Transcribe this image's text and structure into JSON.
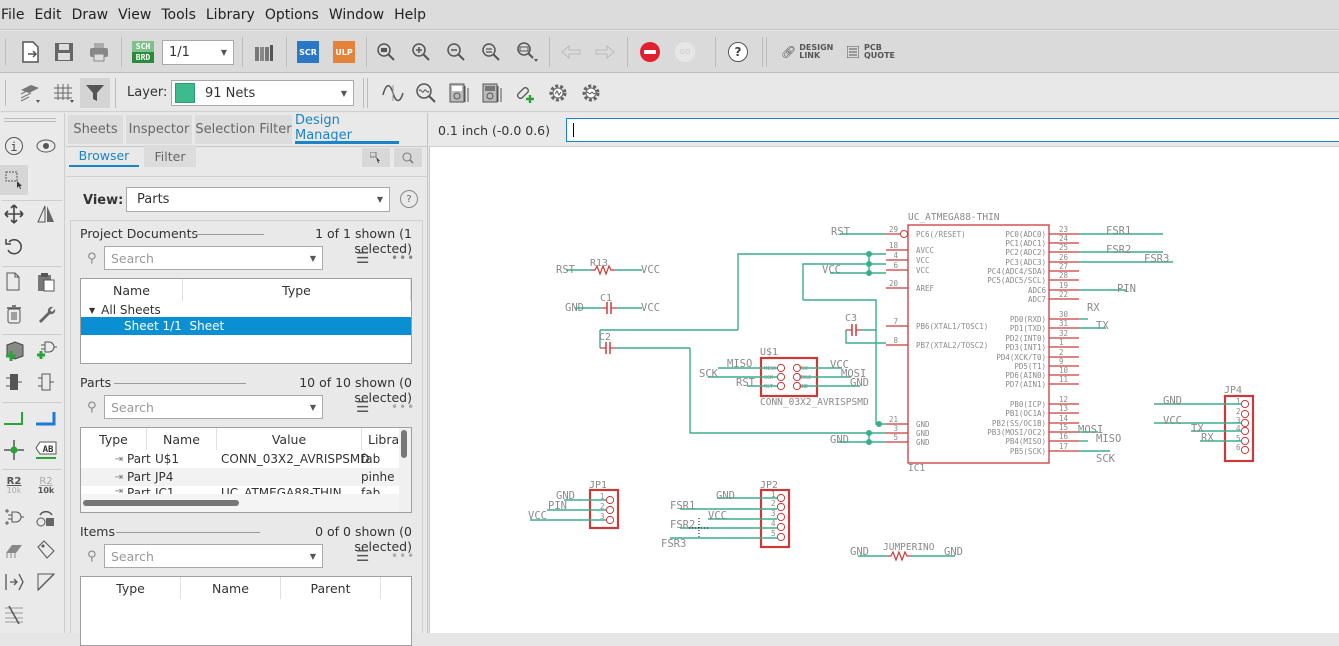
{
  "menu": [
    "File",
    "Edit",
    "Draw",
    "View",
    "Tools",
    "Library",
    "Options",
    "Window",
    "Help"
  ],
  "toolbar": {
    "sheet_select": "1/1",
    "sch_brd_top": "SCH",
    "sch_brd_bottom": "BRD",
    "scr_label": "SCR",
    "ulp_label": "ULP",
    "go_label": "GO",
    "help_label": "?",
    "design_link": [
      "DESIGN",
      "LINK"
    ],
    "pcb_quote": [
      "PCB",
      "QUOTE"
    ],
    "layer_label": "Layer:",
    "layer_value": "91 Nets",
    "layer_color": "#3dbb8f",
    "stop_color": "#e0202e"
  },
  "panel": {
    "tabs": [
      "Sheets",
      "Inspector",
      "Selection Filter",
      "Design Manager"
    ],
    "active_tab": "Design Manager",
    "subtabs": [
      "Browser",
      "Filter"
    ],
    "view_label": "View:",
    "view_value": "Parts",
    "project_documents": {
      "title": "Project Documents",
      "count": "1 of 1 shown (1 selected)",
      "search_placeholder": "Search",
      "columns": [
        "Name",
        "Type"
      ],
      "group": "All Sheets",
      "rows": [
        {
          "name": "Sheet 1/1",
          "type": "Sheet",
          "selected": true
        }
      ]
    },
    "parts": {
      "title": "Parts",
      "count": "10 of 10 shown (0 selected)",
      "search_placeholder": "Search",
      "columns": [
        "Type",
        "Name",
        "Value",
        "Libra"
      ],
      "rows": [
        {
          "type": "Part",
          "name": "U$1",
          "value": "CONN_03X2_AVRISPSMD",
          "library": "fab"
        },
        {
          "type": "Part",
          "name": "JP4",
          "value": "",
          "library": "pinhe"
        },
        {
          "type": "Part",
          "name": "IC1",
          "value": "UC_ATMEGA88-THIN",
          "library": "fab"
        }
      ]
    },
    "items": {
      "title": "Items",
      "count": "0 of 0 shown (0 selected)",
      "search_placeholder": "Search",
      "columns": [
        "Type",
        "Name",
        "Parent"
      ]
    }
  },
  "coord": {
    "readout": "0.1 inch (-0.0 0.6)",
    "command_value": ""
  },
  "lefttools": {
    "r2_top": "R2",
    "r2_bottom": "10k",
    "ab": "AB"
  },
  "schematic": {
    "ic": {
      "name": "IC1",
      "value": "UC_ATMEGA88-THIN",
      "left_pins": [
        {
          "num": "29",
          "label": "PC6(/RESET)"
        },
        {
          "num": "18",
          "label": "AVCC"
        },
        {
          "num": "4",
          "label": "VCC"
        },
        {
          "num": "6",
          "label": "VCC"
        },
        {
          "num": "20",
          "label": "AREF"
        },
        {
          "num": "7",
          "label": "PB6(XTAL1/TOSC1)"
        },
        {
          "num": "8",
          "label": "PB7(XTAL2/TOSC2)"
        },
        {
          "num": "21",
          "label": "GND"
        },
        {
          "num": "3",
          "label": "GND"
        },
        {
          "num": "5",
          "label": "GND"
        }
      ],
      "right_pins": [
        {
          "num": "23",
          "label": "PC0(ADC0)"
        },
        {
          "num": "24",
          "label": "PC1(ADC1)"
        },
        {
          "num": "25",
          "label": "PC2(ADC2)"
        },
        {
          "num": "26",
          "label": "PC3(ADC3)"
        },
        {
          "num": "27",
          "label": "PC4(ADC4/SDA)"
        },
        {
          "num": "28",
          "label": "PC5(ADC5/SCL)"
        },
        {
          "num": "19",
          "label": "ADC6"
        },
        {
          "num": "22",
          "label": "ADC7"
        },
        {
          "num": "30",
          "label": "PD0(RXD)"
        },
        {
          "num": "31",
          "label": "PD1(TXD)"
        },
        {
          "num": "32",
          "label": "PD2(INT0)"
        },
        {
          "num": "1",
          "label": "PD3(INT1)"
        },
        {
          "num": "2",
          "label": "PD4(XCK/T0)"
        },
        {
          "num": "9",
          "label": "PD5(T1)"
        },
        {
          "num": "10",
          "label": "PD6(AIN0)"
        },
        {
          "num": "11",
          "label": "PD7(AIN1)"
        },
        {
          "num": "12",
          "label": "PB0(ICP)"
        },
        {
          "num": "13",
          "label": "PB1(OC1A)"
        },
        {
          "num": "14",
          "label": "PB2(SS/OC1B)"
        },
        {
          "num": "15",
          "label": "PB3(MOSI/OC2)"
        },
        {
          "num": "16",
          "label": "PB4(MISO)"
        },
        {
          "num": "17",
          "label": "PB5(SCK)"
        }
      ]
    },
    "net_labels": {
      "rst_ic": "RST",
      "fsr1": "FSR1",
      "fsr2": "FSR2",
      "fsr3": "FSR3",
      "pin": "PIN",
      "rx": "RX",
      "tx": "TX",
      "mosi": "MOSI",
      "miso": "MISO",
      "sck": "SCK",
      "vcc": "VCC",
      "gnd": "GND"
    },
    "r13": {
      "name": "R13",
      "left": "RST",
      "right": "VCC"
    },
    "c1": {
      "name": "C1",
      "left": "GND",
      "right": "VCC"
    },
    "c2": {
      "name": "C2"
    },
    "c3": {
      "name": "C3"
    },
    "u1": {
      "name": "U$1",
      "value": "CONN_03X2_AVRISPSMD",
      "pins_left": [
        "MISO",
        "SCK",
        "RST"
      ],
      "pins_right": [
        "VCC",
        "MOSI",
        "GND"
      ]
    },
    "jp1": {
      "name": "JP1",
      "nets": [
        "GND",
        "PIN",
        "VCC"
      ],
      "pins": [
        "1",
        "2",
        "3"
      ]
    },
    "jp2": {
      "name": "JP2",
      "nets": [
        "GND",
        "FSR1",
        "VCC",
        "FSR2",
        "FSR3"
      ],
      "pins": [
        "1",
        "2",
        "3",
        "4",
        "5"
      ]
    },
    "jp4": {
      "name": "JP4",
      "nets": [
        "GND",
        "VCC",
        "TX",
        "RX"
      ],
      "pins": [
        "1",
        "2",
        "3",
        "4",
        "5",
        "6"
      ]
    },
    "jumper": {
      "name": "JUMPERINO",
      "left": "GND",
      "right": "GND"
    }
  }
}
